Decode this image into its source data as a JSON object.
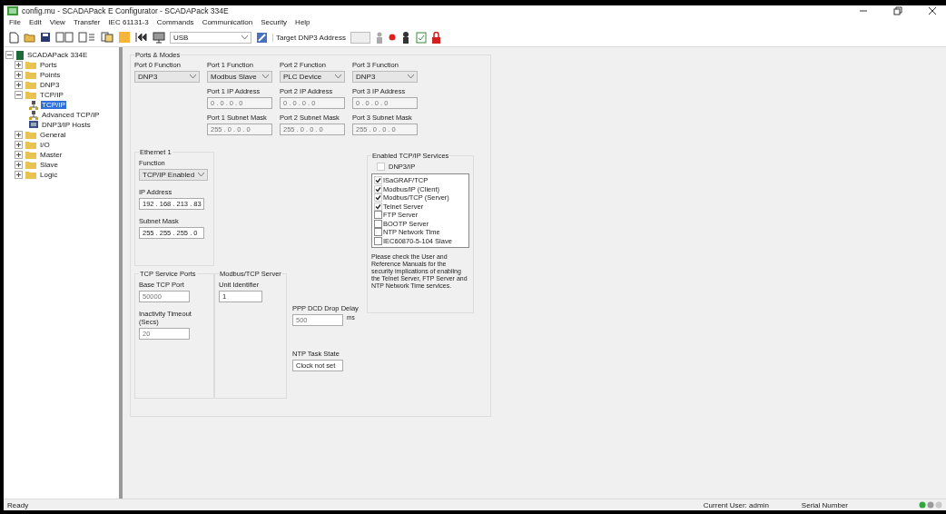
{
  "window": {
    "title": "config.mu - SCADAPack E Configurator - SCADAPack 334E"
  },
  "menu": [
    "File",
    "Edit",
    "View",
    "Transfer",
    "IEC 61131-3",
    "Commands",
    "Communication",
    "Security",
    "Help"
  ],
  "toolbar": {
    "port": "USB",
    "target_label": "Target DNP3 Address"
  },
  "tree": [
    {
      "label": "SCADAPack 334E",
      "kind": "device",
      "expanded": true,
      "selected": false,
      "children": [
        {
          "label": "Ports",
          "kind": "folder",
          "expanded": false,
          "selected": false
        },
        {
          "label": "Points",
          "kind": "folder",
          "expanded": false,
          "selected": false
        },
        {
          "label": "DNP3",
          "kind": "folder",
          "expanded": false,
          "selected": false
        },
        {
          "label": "TCP/IP",
          "kind": "folder",
          "expanded": true,
          "selected": false,
          "children": [
            {
              "label": "TCP/IP",
              "kind": "network",
              "selected": true
            },
            {
              "label": "Advanced TCP/IP",
              "kind": "network",
              "selected": false
            },
            {
              "label": "DNP3/IP Hosts",
              "kind": "hosts",
              "selected": false
            }
          ]
        },
        {
          "label": "General",
          "kind": "folder",
          "expanded": false,
          "selected": false
        },
        {
          "label": "I/O",
          "kind": "folder",
          "expanded": false,
          "selected": false
        },
        {
          "label": "Master",
          "kind": "folder",
          "expanded": false,
          "selected": false
        },
        {
          "label": "Slave",
          "kind": "folder",
          "expanded": false,
          "selected": false
        },
        {
          "label": "Logic",
          "kind": "folder",
          "expanded": false,
          "selected": false
        }
      ]
    }
  ],
  "ports_modes": {
    "title": "Ports & Modes",
    "functions": [
      {
        "label": "Port 0 Function",
        "value": "DNP3"
      },
      {
        "label": "Port 1 Function",
        "value": "Modbus Slave"
      },
      {
        "label": "Port 2 Function",
        "value": "PLC Device"
      },
      {
        "label": "Port 3 Function",
        "value": "DNP3"
      }
    ],
    "ip_addresses": [
      {
        "label": "Port 1 IP Address",
        "value": "0 . 0 . 0 . 0"
      },
      {
        "label": "Port 2 IP Address",
        "value": "0 . 0 . 0 . 0"
      },
      {
        "label": "Port 3 IP Address",
        "value": "0 . 0 . 0 . 0"
      }
    ],
    "subnet_masks": [
      {
        "label": "Port 1 Subnet Mask",
        "value": "255 . 0 . 0 . 0"
      },
      {
        "label": "Port 2 Subnet Mask",
        "value": "255 . 0 . 0 . 0"
      },
      {
        "label": "Port 3 Subnet Mask",
        "value": "255 . 0 . 0 . 0"
      }
    ]
  },
  "ethernet": {
    "title": "Ethernet 1",
    "function_label": "Function",
    "function_value": "TCP/IP Enabled",
    "ip_label": "IP Address",
    "ip_value": "192 . 168 . 213 . 83",
    "mask_label": "Subnet Mask",
    "mask_value": "255 . 255 . 255 . 0"
  },
  "services": {
    "title": "Enabled TCP/IP Services",
    "dnp3": {
      "label": "DNP3/IP",
      "checked": false
    },
    "items": [
      {
        "label": "ISaGRAF/TCP",
        "checked": true
      },
      {
        "label": "Modbus/IP (Client)",
        "checked": true
      },
      {
        "label": "Modbus/TCP (Server)",
        "checked": true
      },
      {
        "label": "Telnet Server",
        "checked": true
      },
      {
        "label": "FTP Server",
        "checked": false
      },
      {
        "label": "BOOTP Server",
        "checked": false
      },
      {
        "label": "NTP Network Time",
        "checked": false
      },
      {
        "label": "IEC60870-5-104 Slave",
        "checked": false
      }
    ],
    "note": "Please check the User and Reference Manuals for the security implications of enabling the Telnet Server, FTP Server and NTP Network Time services."
  },
  "tcp_ports": {
    "title": "TCP Service Ports",
    "base_label": "Base TCP Port",
    "base_value": "50000",
    "timeout_label": "Inactivity Timeout (Secs)",
    "timeout_value": "20"
  },
  "modbus": {
    "title": "Modbus/TCP Server",
    "unit_label": "Unit Identifier",
    "unit_value": "1"
  },
  "ppp": {
    "label": "PPP DCD Drop Delay",
    "value": "500",
    "unit": "ms"
  },
  "ntp": {
    "label": "NTP Task State",
    "value": "Clock not set"
  },
  "status_bar": {
    "text": "Ready",
    "user": "Current User: admin",
    "serial": "Serial Number"
  }
}
